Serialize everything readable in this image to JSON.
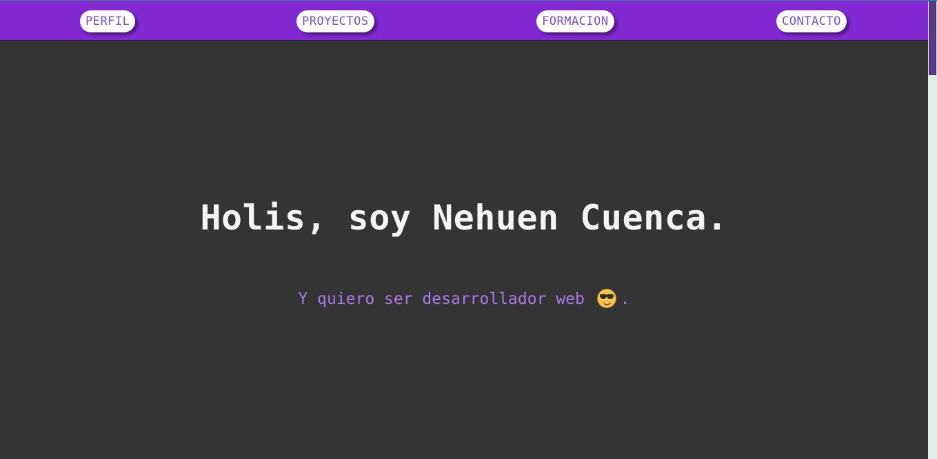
{
  "nav": {
    "items": [
      {
        "label": "PERFIL"
      },
      {
        "label": "PROYECTOS"
      },
      {
        "label": "FORMACION"
      },
      {
        "label": "CONTACTO"
      }
    ]
  },
  "hero": {
    "title": "Holis, soy Nehuen Cuenca.",
    "subtitle_before": "Y quiero ser desarrollador web",
    "subtitle_after": ".",
    "emoji_icon": "smiling-face-with-sunglasses-icon"
  },
  "colors": {
    "header": "#8229d2",
    "background": "#343434",
    "title": "#f4f4f4",
    "subtitle": "#a979ea",
    "nav_text": "#7b4fc6"
  }
}
